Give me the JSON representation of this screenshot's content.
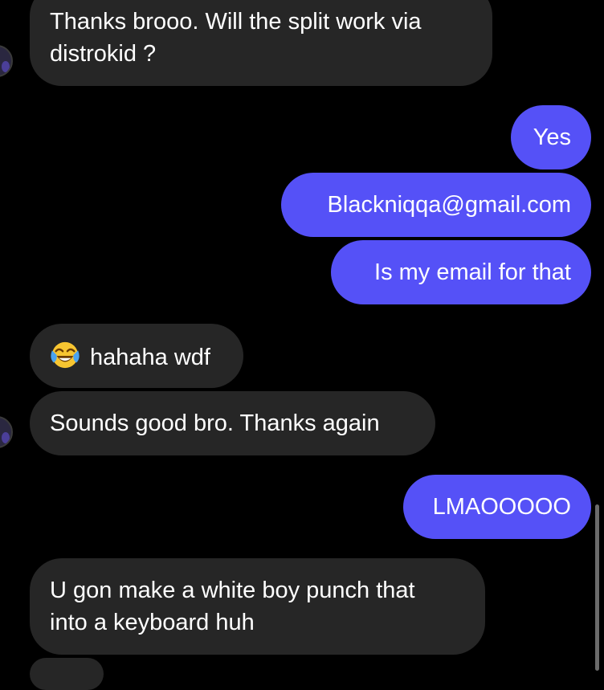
{
  "messages": [
    {
      "id": "m1",
      "sender": "them",
      "lines": [
        "Thanks brooo. Will the split work via",
        "distrokid ?"
      ]
    },
    {
      "id": "m2",
      "sender": "me",
      "lines": [
        "Yes"
      ]
    },
    {
      "id": "m3",
      "sender": "me",
      "lines": [
        "Blackniqqa@gmail.com"
      ]
    },
    {
      "id": "m4",
      "sender": "me",
      "lines": [
        "Is my email for that"
      ]
    },
    {
      "id": "m5",
      "sender": "them",
      "emoji": "face-with-tears-of-joy",
      "lines": [
        "hahaha wdf"
      ]
    },
    {
      "id": "m6",
      "sender": "them",
      "lines": [
        "Sounds good bro. Thanks again"
      ]
    },
    {
      "id": "m7",
      "sender": "me",
      "lines": [
        "LMAOOOOO"
      ]
    },
    {
      "id": "m8",
      "sender": "them",
      "lines": [
        "U gon make a white boy punch that",
        "into a keyboard huh"
      ]
    }
  ],
  "colors": {
    "background": "#000000",
    "incoming_bubble": "#262626",
    "outgoing_bubble": "#5551f7",
    "text": "#ffffff"
  }
}
